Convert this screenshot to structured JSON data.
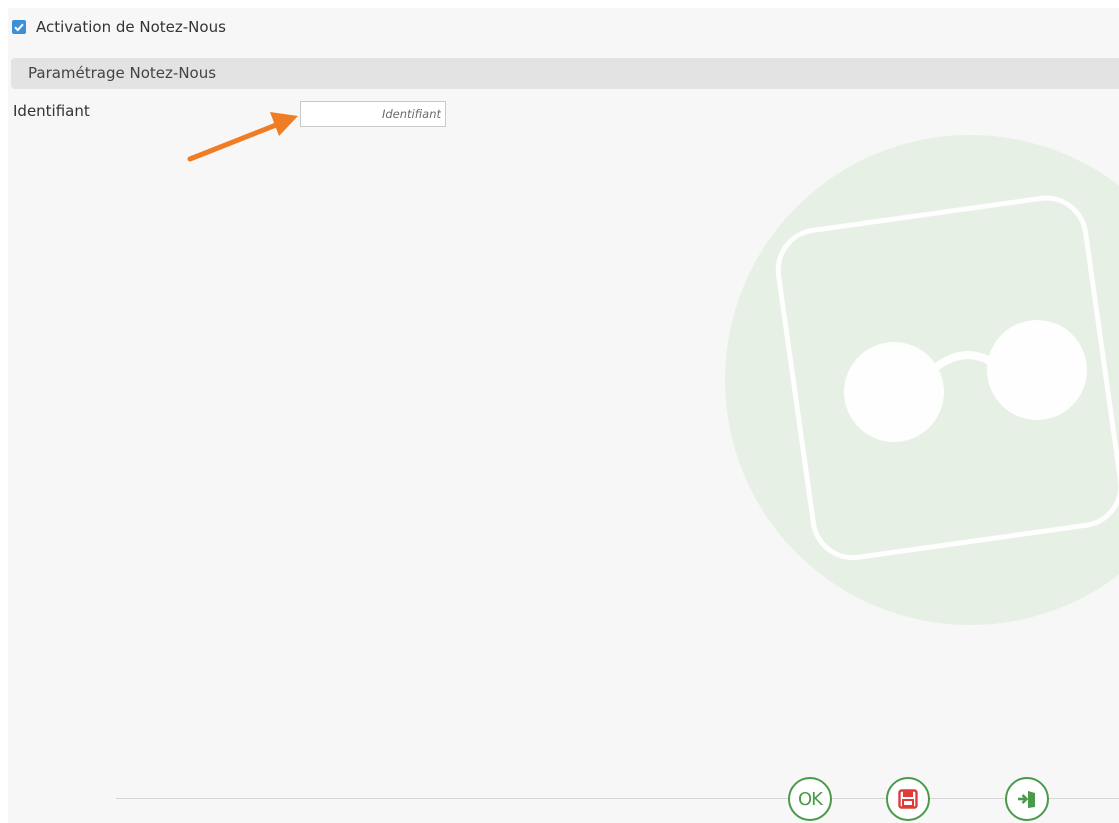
{
  "activation": {
    "label": "Activation de Notez-Nous",
    "checked": true
  },
  "section": {
    "title": "Paramétrage Notez-Nous"
  },
  "identifiant": {
    "label": "Identifiant",
    "placeholder": "Identifiant",
    "value": ""
  },
  "footer": {
    "ok_label": "OK",
    "save_icon": "save-icon",
    "exit_icon": "exit-icon"
  },
  "colors": {
    "checkbox": "#3d8fd6",
    "button_border": "#4a9a49",
    "save_icon": "#e03a3a",
    "annotation_arrow": "#f07d24",
    "watermark": "#e3efe1"
  }
}
